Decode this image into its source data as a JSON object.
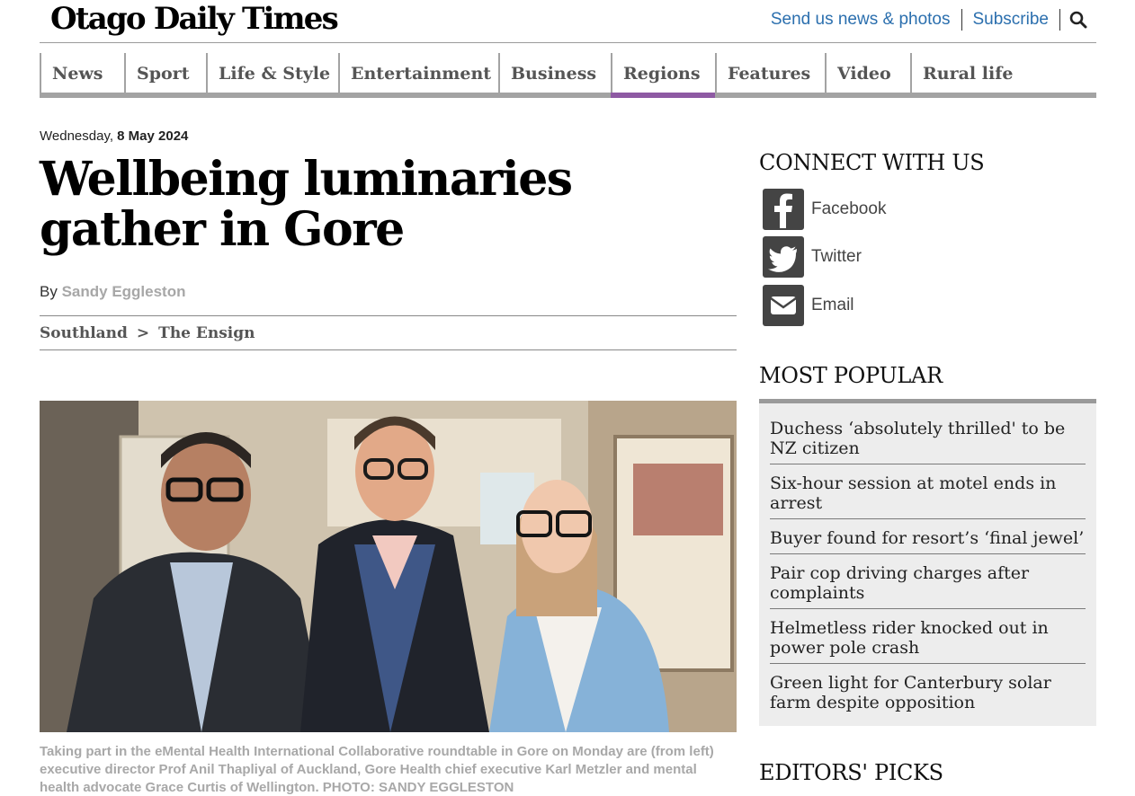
{
  "header": {
    "logo": "Otago Daily Times",
    "links": [
      "Send us news & photos",
      "Subscribe"
    ],
    "search_icon": "search-icon"
  },
  "nav": {
    "items": [
      {
        "label": "News",
        "active": false
      },
      {
        "label": "Sport",
        "active": false
      },
      {
        "label": "Life & Style",
        "active": false
      },
      {
        "label": "Entertainment",
        "active": false
      },
      {
        "label": "Business",
        "active": false
      },
      {
        "label": "Regions",
        "active": true
      },
      {
        "label": "Features",
        "active": false
      },
      {
        "label": "Video",
        "active": false
      },
      {
        "label": "Rural life",
        "active": false
      }
    ],
    "active_color": "#8e5aa3"
  },
  "article": {
    "date_day": "Wednesday,",
    "date_full": "8 May 2024",
    "headline": "Wellbeing luminaries gather in Gore",
    "by": "By",
    "author": "Sandy Eggleston",
    "breadcrumb": [
      "Southland",
      "The Ensign"
    ],
    "breadcrumb_sep": ">",
    "caption": "Taking part in the eMental Health International Collaborative roundtable in Gore on Monday are (from left) executive director Prof Anil Thapliyal of Auckland, Gore Health chief executive Karl Metzler and mental health advocate Grace Curtis of Wellington. PHOTO: SANDY EGGLESTON"
  },
  "sidebar": {
    "connect_title": "CONNECT WITH US",
    "social": [
      {
        "label": "Facebook",
        "icon": "facebook-icon"
      },
      {
        "label": "Twitter",
        "icon": "twitter-icon"
      },
      {
        "label": "Email",
        "icon": "email-icon"
      }
    ],
    "popular_title": "MOST POPULAR",
    "popular": [
      "Duchess ‘absolutely thrilled' to be NZ citizen",
      "Six-hour session at motel ends in arrest",
      "Buyer found for resort’s ‘final jewel’",
      "Pair cop driving charges after complaints",
      "Helmetless rider knocked out in power pole crash",
      "Green light for Canterbury solar farm despite opposition"
    ],
    "editors_title": "EDITORS' PICKS"
  },
  "colors": {
    "link_blue": "#2b6fae",
    "nav_grey": "#a3a3a3",
    "caption_grey": "#a8a8a8"
  }
}
